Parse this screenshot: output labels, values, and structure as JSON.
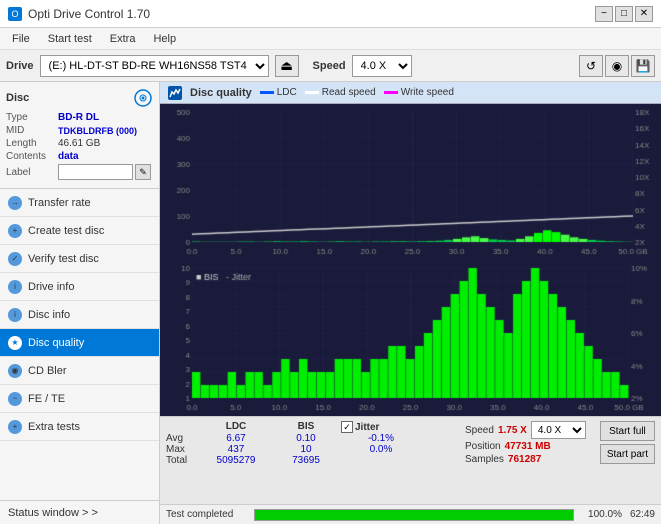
{
  "titlebar": {
    "title": "Opti Drive Control 1.70",
    "minimize": "−",
    "maximize": "□",
    "close": "✕"
  },
  "menubar": {
    "items": [
      "File",
      "Start test",
      "Extra",
      "Help"
    ]
  },
  "drivebar": {
    "label": "Drive",
    "drive_value": "(E:)  HL-DT-ST BD-RE  WH16NS58 TST4",
    "speed_label": "Speed",
    "speed_value": "4.0 X"
  },
  "disc_panel": {
    "title": "Disc",
    "type_label": "Type",
    "type_value": "BD-R DL",
    "mid_label": "MID",
    "mid_value": "TDKBLDRFB (000)",
    "length_label": "Length",
    "length_value": "46.61 GB",
    "contents_label": "Contents",
    "contents_value": "data",
    "label_label": "Label",
    "label_value": ""
  },
  "nav": {
    "items": [
      {
        "label": "Transfer rate",
        "active": false
      },
      {
        "label": "Create test disc",
        "active": false
      },
      {
        "label": "Verify test disc",
        "active": false
      },
      {
        "label": "Drive info",
        "active": false
      },
      {
        "label": "Disc info",
        "active": false
      },
      {
        "label": "Disc quality",
        "active": true
      },
      {
        "label": "CD Bler",
        "active": false
      },
      {
        "label": "FE / TE",
        "active": false
      },
      {
        "label": "Extra tests",
        "active": false
      }
    ],
    "status_window": "Status window > >"
  },
  "disc_quality": {
    "title": "Disc quality",
    "legend": {
      "ldc_label": "LDC",
      "ldc_color": "#0000ff",
      "read_speed_label": "Read speed",
      "read_speed_color": "#ffffff",
      "write_speed_label": "Write speed",
      "write_speed_color": "#ff00ff"
    },
    "top_chart": {
      "y_max": 500,
      "y_right_labels": [
        "18X",
        "16X",
        "14X",
        "12X",
        "10X",
        "8X",
        "6X",
        "4X",
        "2X"
      ]
    },
    "bottom_chart": {
      "y_labels": [
        "10",
        "9",
        "8",
        "7",
        "6",
        "5",
        "4",
        "3",
        "2",
        "1"
      ],
      "y_right_labels": [
        "10%",
        "8%",
        "6%",
        "4%",
        "2%"
      ],
      "bis_label": "BIS",
      "jitter_label": "Jitter"
    }
  },
  "stats": {
    "ldc_header": "LDC",
    "bis_header": "BIS",
    "jitter_header": "Jitter",
    "jitter_checkbox": true,
    "avg_label": "Avg",
    "max_label": "Max",
    "total_label": "Total",
    "avg_ldc": "6.67",
    "avg_bis": "0.10",
    "avg_jitter": "-0.1%",
    "max_ldc": "437",
    "max_bis": "10",
    "max_jitter": "0.0%",
    "total_ldc": "5095279",
    "total_bis": "73695",
    "speed_label": "Speed",
    "speed_value": "1.75 X",
    "position_label": "Position",
    "position_value": "47731 MB",
    "samples_label": "Samples",
    "samples_value": "761287",
    "speed_select": "4.0 X",
    "start_full_btn": "Start full",
    "start_part_btn": "Start part"
  },
  "progress": {
    "label": "Test completed",
    "percent": 100,
    "percent_display": "100.0%",
    "time": "62:49"
  },
  "chart_data": {
    "top_bars": [
      2,
      1,
      1,
      1,
      1,
      2,
      2,
      1,
      2,
      3,
      2,
      2,
      3,
      2,
      1,
      2,
      3,
      2,
      2,
      1,
      2,
      2,
      3,
      3,
      2,
      3,
      4,
      5,
      8,
      12,
      18,
      22,
      15,
      10,
      8,
      6,
      12,
      22,
      35,
      45,
      38,
      28,
      18,
      12,
      8,
      5,
      3,
      2,
      1
    ],
    "bottom_bars": [
      2,
      1,
      1,
      1,
      2,
      1,
      2,
      2,
      1,
      2,
      3,
      2,
      3,
      2,
      2,
      2,
      3,
      3,
      3,
      2,
      3,
      3,
      4,
      4,
      3,
      4,
      5,
      6,
      7,
      8,
      9,
      10,
      8,
      7,
      6,
      5,
      8,
      9,
      10,
      9,
      8,
      7,
      6,
      5,
      4,
      3,
      2,
      2,
      1
    ]
  }
}
